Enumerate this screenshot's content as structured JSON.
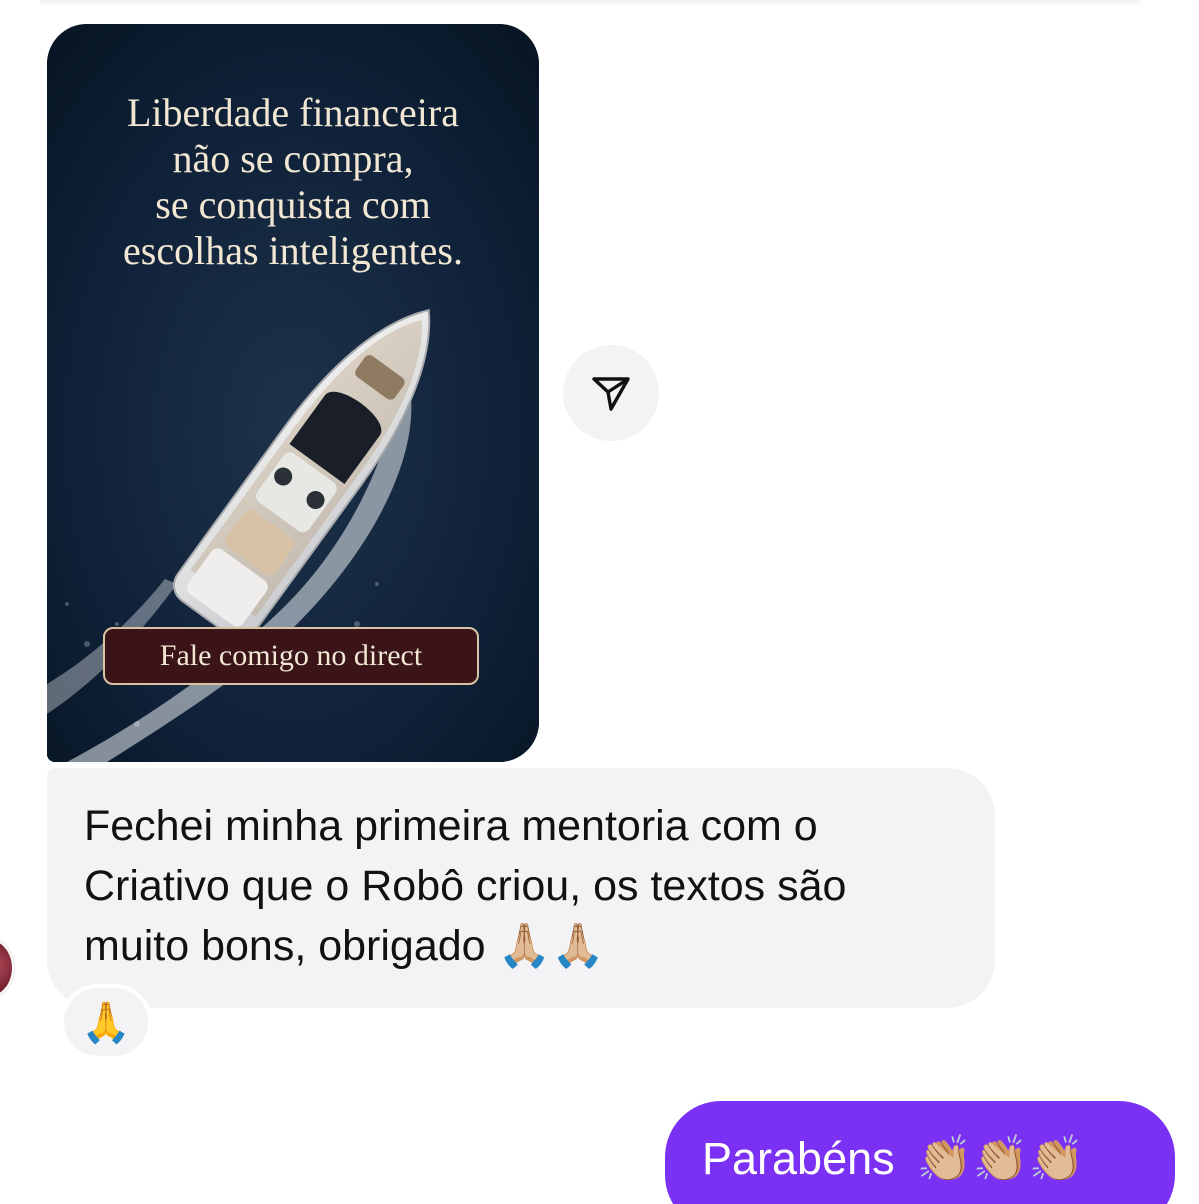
{
  "shared_post": {
    "headline": [
      "Liberdade financeira",
      "não se compra,",
      "se conquista com",
      "escolhas inteligentes."
    ],
    "cta_label": "Fale comigo no direct",
    "image_icon": "yacht-photo"
  },
  "share_button": {
    "icon": "paper-plane-icon"
  },
  "incoming_message": {
    "lines": [
      "Fechei minha primeira mentoria com o",
      "Criativo que o Robô criou, os textos são",
      "muito bons, obrigado"
    ],
    "trailing_emoji": "🙏🏼🙏🏼",
    "reaction": "🙏"
  },
  "outgoing_message": {
    "text": "Parabéns",
    "trailing_emoji": "👏🏼👏🏼👏🏼"
  },
  "colors": {
    "outgoing_bubble": "#7b31f4",
    "incoming_bubble": "#f3f3f5",
    "post_background": "#112438",
    "cta_background": "#3a1418",
    "headline_text": "#f1e7d3"
  }
}
